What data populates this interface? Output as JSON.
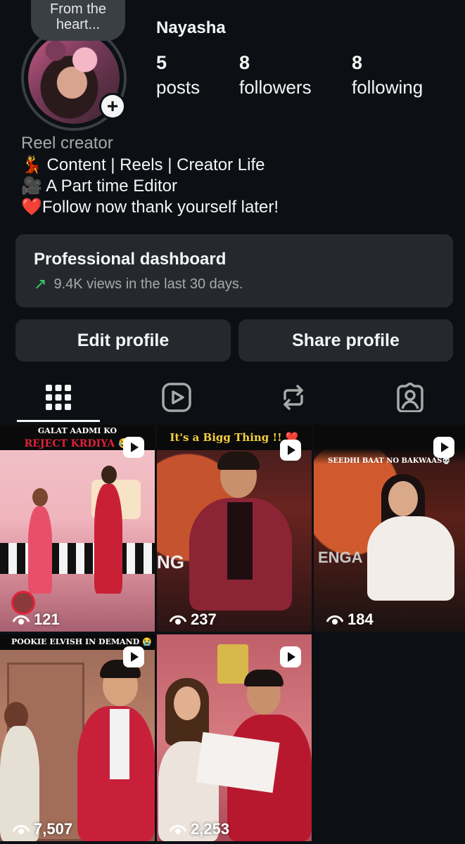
{
  "profile": {
    "note": "From the heart...",
    "username": "Nayasha",
    "stats": [
      {
        "value": "5",
        "label": "posts"
      },
      {
        "value": "8",
        "label": "followers"
      },
      {
        "value": "8",
        "label": "following"
      }
    ],
    "category": "Reel creator",
    "bio": [
      "💃 Content | Reels | Creator Life",
      "🎥 A Part time Editor",
      "❤️Follow now thank yourself later!"
    ]
  },
  "dashboard": {
    "title": "Professional dashboard",
    "subtitle": "9.4K views in the last 30 days."
  },
  "buttons": {
    "edit": "Edit profile",
    "share": "Share profile"
  },
  "tabs": [
    {
      "icon": "grid-icon",
      "active": true
    },
    {
      "icon": "reels-icon",
      "active": false
    },
    {
      "icon": "repost-icon",
      "active": false
    },
    {
      "icon": "tagged-icon",
      "active": false
    }
  ],
  "posts": [
    {
      "caption_top": "GALAT AADMI KO",
      "caption": "REJECT KRDIYA 😂",
      "views": "121"
    },
    {
      "caption": "It's a Bigg Thing !! ❤️",
      "views": "237"
    },
    {
      "caption": "SEEDHI BAAT NO BAKWAAS💀",
      "views": "184"
    },
    {
      "caption": "POOKIE ELVISH IN DEMAND 😭",
      "views": "7,507"
    },
    {
      "caption": "",
      "views": "2,253"
    }
  ],
  "colors": {
    "background": "#0c1014",
    "card": "#25292e",
    "accent_green": "#3ccf6a",
    "reject_red": "#e0213a",
    "bigg_yellow": "#f4d03f"
  }
}
